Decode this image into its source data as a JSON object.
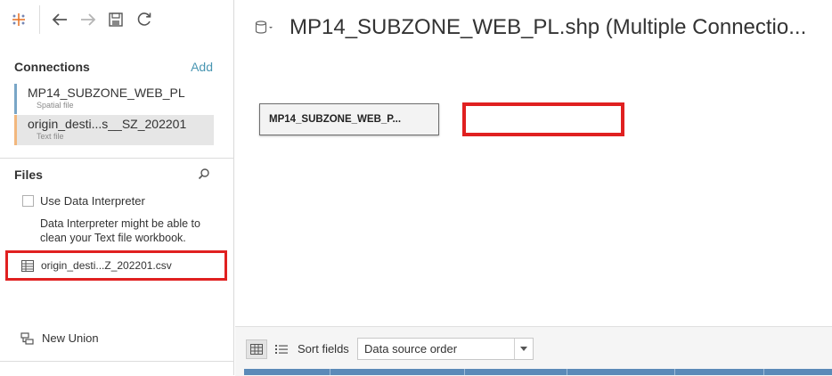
{
  "toolbar": {
    "icons": [
      "tableau-logo-icon",
      "back-arrow-icon",
      "forward-arrow-icon",
      "save-icon",
      "refresh-icon"
    ]
  },
  "connections": {
    "title": "Connections",
    "add_label": "Add",
    "items": [
      {
        "name": "MP14_SUBZONE_WEB_PL",
        "type": "Spatial file",
        "color": "#79a6c7"
      },
      {
        "name": "origin_desti...s__SZ_202201",
        "type": "Text file",
        "color": "#f2b77d"
      }
    ]
  },
  "files": {
    "title": "Files",
    "use_interpreter_label": "Use Data Interpreter",
    "interpreter_hint": "Data Interpreter might be able to clean your Text file workbook.",
    "file_item": "origin_desti...Z_202201.csv",
    "new_union_label": "New Union"
  },
  "main": {
    "title": "MP14_SUBZONE_WEB_PL.shp (Multiple Connectio...",
    "table_card_label": "MP14_SUBZONE_WEB_P...",
    "sort_label": "Sort fields",
    "sort_value": "Data source order"
  },
  "colors": {
    "highlight_red": "#e02020",
    "accent_blue": "#4996b2"
  }
}
